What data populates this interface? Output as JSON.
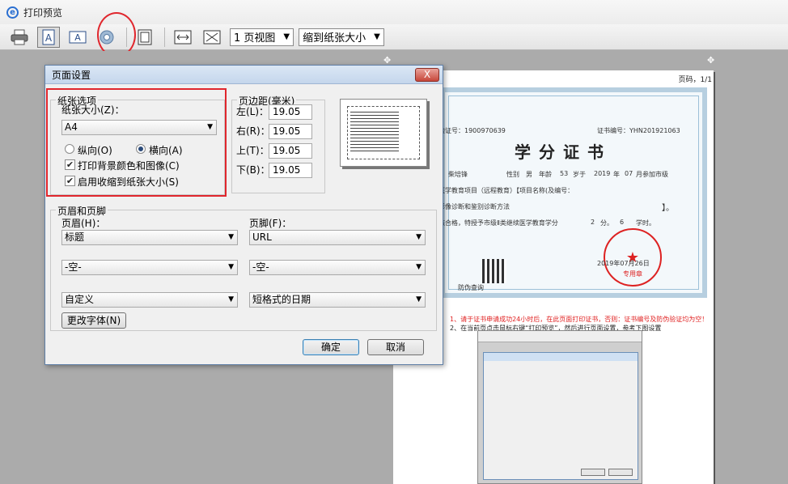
{
  "window": {
    "title": "打印预览"
  },
  "toolbar": {
    "view_select": "1 页视图",
    "shrink_select": "缩到纸张大小"
  },
  "preview": {
    "page_number": "页码，1/1",
    "cert": {
      "title": "学分证书",
      "serial_left": "验证号：1900970639",
      "serial_right": "证书编号：YHN201921063",
      "line1_name": "柴培锋",
      "line1_gender_label": "性别",
      "line1_gender": "男",
      "line1_age_label": "年龄",
      "line1_age": "53",
      "line1_year_label": "岁于",
      "line1_year": "2019",
      "line1_year_unit": "年",
      "line1_month": "07",
      "line1_month_text": "月参加市级",
      "line2": "医学教育项目（远程教育）【项目名称(及编号：",
      "line3": "影像诊断和鉴别诊断方法",
      "line3_end": "】。",
      "line4": "核合格，特授予市级Ⅱ类继续医学教育学分",
      "line4_credit": "2",
      "line4_unit": "分。",
      "line4_hours": "6",
      "line4_hours_unit": "学时。",
      "date": "2019年07月26日",
      "seal_text": "专用章",
      "query_text": "防伪查询"
    },
    "note1": "1、请于证书申请成功24小时后，在此页面打印证书，否则：证书编号及防伪验证均为空！",
    "note2": "2、在当前页点击鼠标右键“打印预览”，然后进行页面设置，参考下图设置"
  },
  "dialog": {
    "title": "页面设置",
    "close": "X",
    "paper_group": "纸张选项",
    "paper_size_label": "纸张大小(Z)：",
    "paper_size_value": "A4",
    "portrait": "纵向(O)",
    "landscape": "横向(A)",
    "print_bg": "打印背景颜色和图像(C)",
    "shrink": "启用收缩到纸张大小(S)",
    "margin_group": "页边距(毫米)",
    "margin_left_label": "左(L)：",
    "margin_left": "19.05",
    "margin_right_label": "右(R)：",
    "margin_right": "19.05",
    "margin_top_label": "上(T)：",
    "margin_top": "19.05",
    "margin_bottom_label": "下(B)：",
    "margin_bottom": "19.05",
    "hf_group": "页眉和页脚",
    "header_label": "页眉(H)：",
    "footer_label": "页脚(F)：",
    "header1": "标题",
    "footer1": "URL",
    "header2": "-空-",
    "footer2": "-空-",
    "header3": "自定义",
    "footer3": "短格式的日期",
    "change_font": "更改字体(N)",
    "ok": "确定",
    "cancel": "取消"
  },
  "colors": {
    "highlight_red": "#e0262d"
  }
}
